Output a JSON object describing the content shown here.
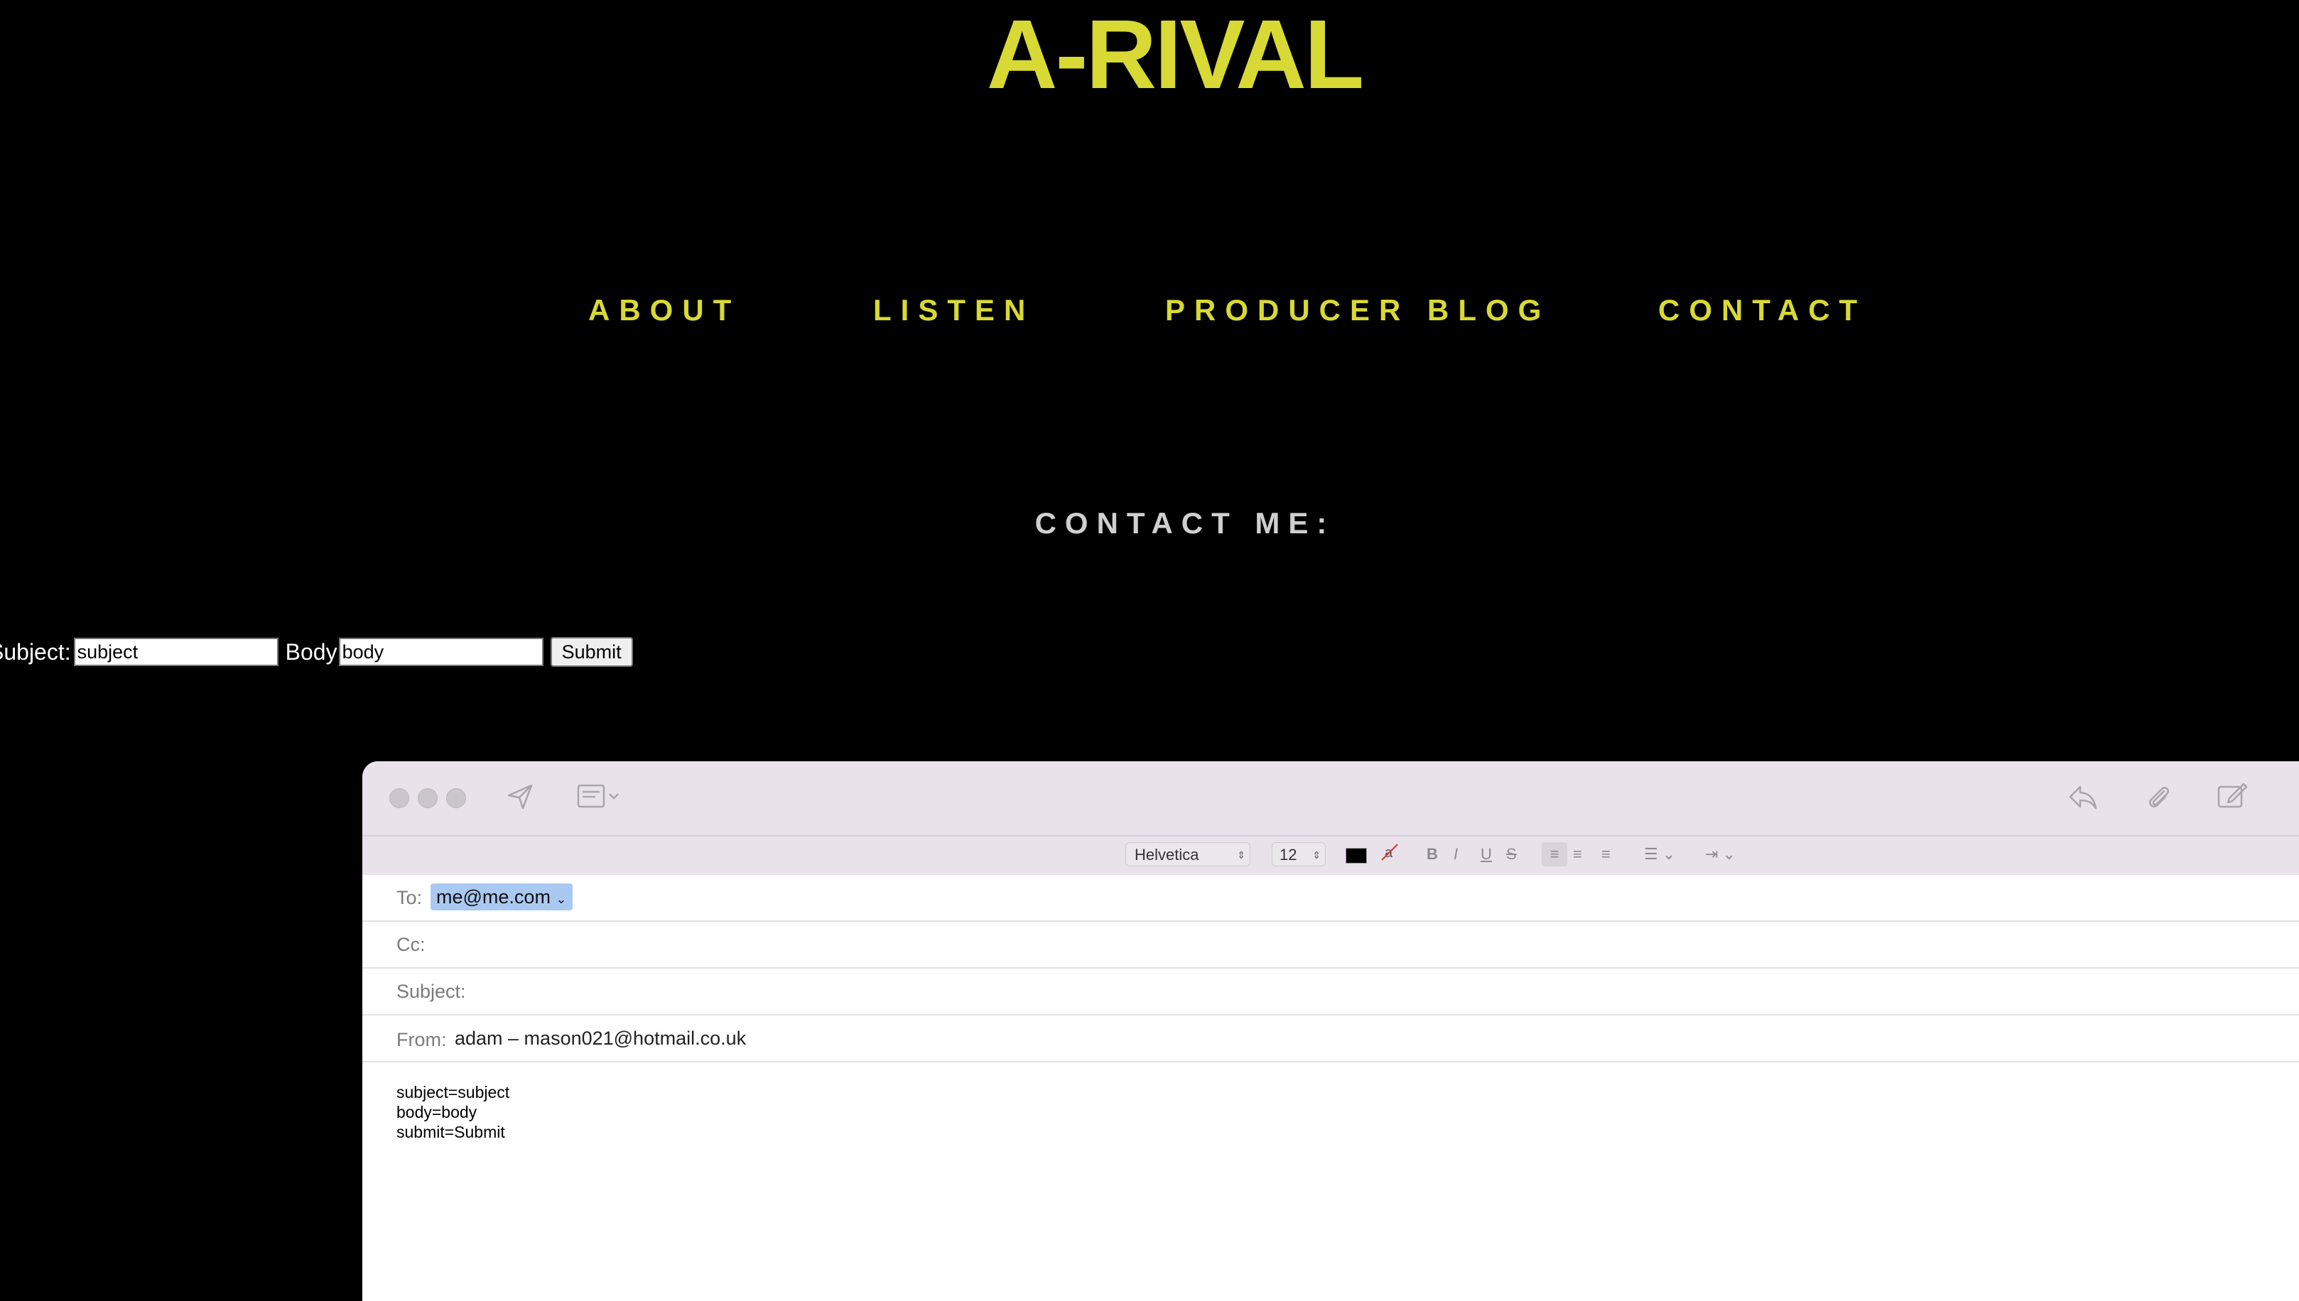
{
  "site": {
    "title": "A-RIVAL",
    "accent_color": "#d8d934",
    "heading_color": "#cfcfcf",
    "nav": [
      {
        "label": "ABOUT"
      },
      {
        "label": "LISTEN"
      },
      {
        "label": "PRODUCER BLOG"
      },
      {
        "label": "CONTACT"
      }
    ],
    "contact_heading": "CONTACT ME:",
    "form": {
      "subject_label": "Subject:",
      "subject_value": "subject",
      "body_label": "Body",
      "body_value": "body",
      "submit_label": "Submit"
    }
  },
  "mail": {
    "toolbar_icons": [
      "send-icon",
      "header-fields-icon",
      "reply-icon",
      "attachment-icon",
      "markup-icon"
    ],
    "format": {
      "font": "Helvetica",
      "size": "12",
      "icons": [
        "text-color-icon",
        "background-color-icon",
        "bold-icon",
        "italic-icon",
        "underline-icon",
        "strikethrough-icon",
        "align-left-icon",
        "align-center-icon",
        "align-right-icon",
        "list-icon",
        "indent-icon"
      ]
    },
    "to_label": "To:",
    "to_value": "me@me.com",
    "cc_label": "Cc:",
    "subject_label": "Subject:",
    "from_label": "From:",
    "from_value": "adam – mason021@hotmail.co.uk",
    "body_lines": [
      "subject=subject",
      "body=body",
      "submit=Submit"
    ]
  }
}
